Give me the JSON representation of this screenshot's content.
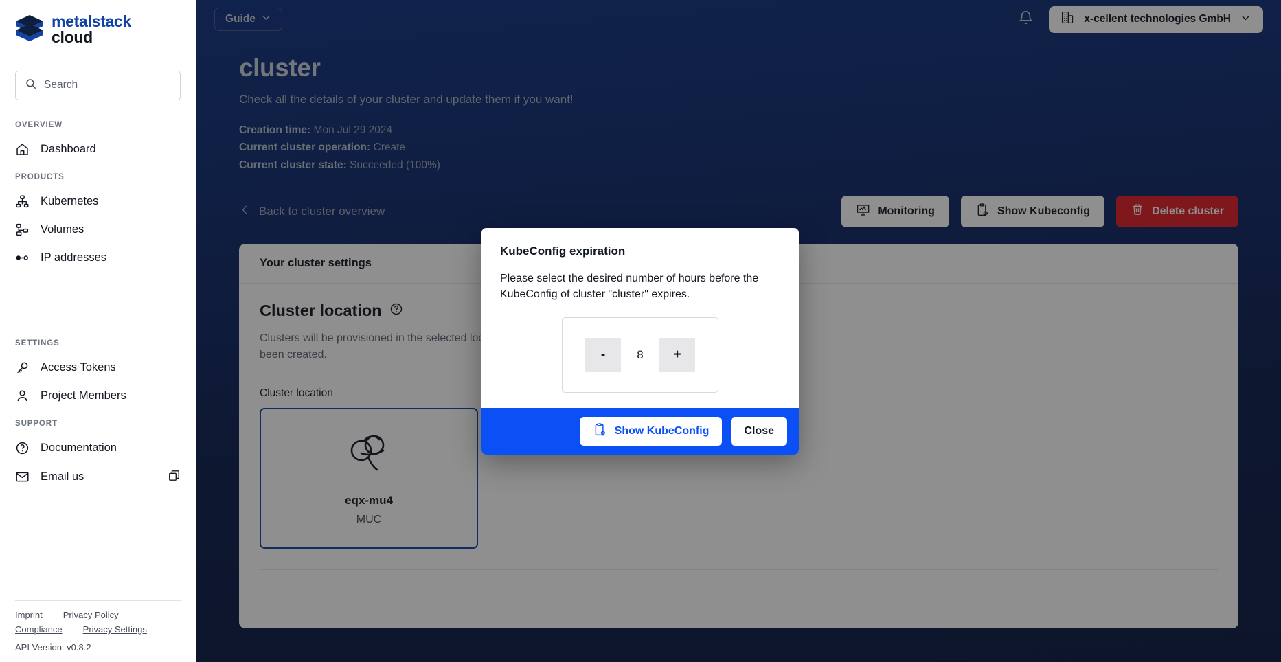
{
  "brand": {
    "line1": "metalstack",
    "line2": "cloud",
    "primary": "#1142a6",
    "accent": "#0a50f5",
    "danger": "#e01b24"
  },
  "sidebar": {
    "search": {
      "placeholder": "Search",
      "value": "",
      "icon": "search-icon"
    },
    "groups": [
      {
        "label": "OVERVIEW",
        "items": [
          {
            "label": "Dashboard",
            "icon": "home-icon"
          }
        ]
      },
      {
        "label": "PRODUCTS",
        "items": [
          {
            "label": "Kubernetes",
            "icon": "kubernetes-icon"
          },
          {
            "label": "Volumes",
            "icon": "volumes-icon"
          },
          {
            "label": "IP addresses",
            "icon": "ip-address-icon"
          }
        ]
      },
      {
        "label": "SETTINGS",
        "items": [
          {
            "label": "Access Tokens",
            "icon": "key-icon"
          },
          {
            "label": "Project Members",
            "icon": "user-icon"
          }
        ]
      },
      {
        "label": "SUPPORT",
        "items": [
          {
            "label": "Documentation",
            "icon": "question-circle-icon"
          },
          {
            "label": "Email us",
            "icon": "envelope-icon",
            "trailing_icon": "external-link-icon"
          }
        ]
      }
    ],
    "footer": {
      "links": [
        "Imprint",
        "Privacy Policy",
        "Compliance",
        "Privacy Settings"
      ],
      "api_version": "API Version: v0.8.2"
    }
  },
  "topbar": {
    "guide_label": "Guide",
    "guide_chevron": "chevron-down-icon",
    "bell": "bell-icon",
    "org_name": "x-cellent technologies GmbH",
    "org_icon": "building-icon",
    "org_chevron": "chevron-down-icon"
  },
  "header": {
    "title": "cluster",
    "subtitle": "Check all the details of your cluster and update them if you want!",
    "meta": [
      {
        "label": "Creation time:",
        "value": "Mon Jul 29 2024"
      },
      {
        "label": "Current cluster operation:",
        "value": "Create"
      },
      {
        "label": "Current cluster state:",
        "value": "Succeeded (100%)"
      }
    ]
  },
  "actions": {
    "back_label": "Back to cluster overview",
    "back_icon": "chevron-left-icon",
    "monitoring_label": "Monitoring",
    "monitoring_icon": "monitor-chart-icon",
    "kubeconfig_label": "Show Kubeconfig",
    "kubeconfig_icon": "clipboard-gear-icon",
    "delete_label": "Delete cluster",
    "delete_icon": "trash-icon"
  },
  "panel": {
    "head": "Your cluster settings",
    "section_title": "Cluster location",
    "section_help_icon": "help-circle-icon",
    "section_desc": "Clusters will be provisioned in the selected location. Locations can't be changed once your cluster has been created.",
    "field_label": "Cluster location",
    "location": {
      "icon": "pretzel-icon",
      "name": "eqx-mu4",
      "code": "MUC"
    }
  },
  "modal": {
    "title": "KubeConfig expiration",
    "text": "Please select the desired number of hours before the KubeConfig of cluster \"cluster\" expires.",
    "stepper": {
      "decrement": "-",
      "value": "8",
      "increment": "+"
    },
    "primary_label": "Show KubeConfig",
    "primary_icon": "clipboard-gear-icon",
    "close_label": "Close"
  }
}
